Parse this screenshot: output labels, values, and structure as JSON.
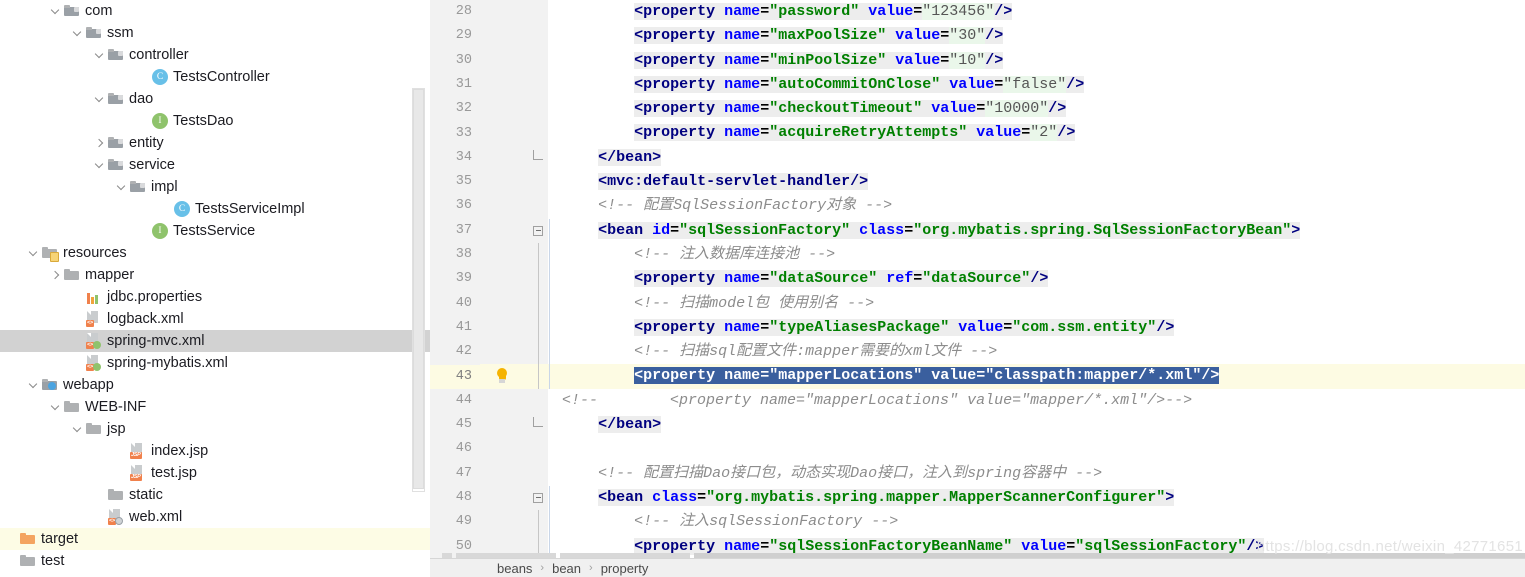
{
  "project_tree": {
    "items": [
      {
        "label": "com",
        "indent": 2,
        "arrow": "down",
        "icon": "package-folder-icon",
        "state": "none"
      },
      {
        "label": "ssm",
        "indent": 3,
        "arrow": "down",
        "icon": "package-folder-icon",
        "state": "none"
      },
      {
        "label": "controller",
        "indent": 4,
        "arrow": "down",
        "icon": "package-folder-icon",
        "state": "none"
      },
      {
        "label": "TestsController",
        "indent": 6,
        "arrow": "none",
        "icon": "java-class-icon",
        "state": "none"
      },
      {
        "label": "dao",
        "indent": 4,
        "arrow": "down",
        "icon": "package-folder-icon",
        "state": "none"
      },
      {
        "label": "TestsDao",
        "indent": 6,
        "arrow": "none",
        "icon": "java-interface-icon",
        "state": "none"
      },
      {
        "label": "entity",
        "indent": 4,
        "arrow": "right",
        "icon": "package-folder-icon",
        "state": "none"
      },
      {
        "label": "service",
        "indent": 4,
        "arrow": "down",
        "icon": "package-folder-icon",
        "state": "none"
      },
      {
        "label": "impl",
        "indent": 5,
        "arrow": "down",
        "icon": "package-folder-icon",
        "state": "none"
      },
      {
        "label": "TestsServiceImpl",
        "indent": 7,
        "arrow": "none",
        "icon": "java-class-icon",
        "state": "none"
      },
      {
        "label": "TestsService",
        "indent": 6,
        "arrow": "none",
        "icon": "java-interface-icon",
        "state": "none"
      },
      {
        "label": "resources",
        "indent": 1,
        "arrow": "down",
        "icon": "resources-folder-icon",
        "state": "none"
      },
      {
        "label": "mapper",
        "indent": 2,
        "arrow": "right",
        "icon": "folder-icon",
        "state": "none"
      },
      {
        "label": "jdbc.properties",
        "indent": 3,
        "arrow": "none",
        "icon": "properties-file-icon",
        "state": "none"
      },
      {
        "label": "logback.xml",
        "indent": 3,
        "arrow": "none",
        "icon": "xml-file-icon",
        "state": "none"
      },
      {
        "label": "spring-mvc.xml",
        "indent": 3,
        "arrow": "none",
        "icon": "spring-xml-file-icon",
        "state": "selected"
      },
      {
        "label": "spring-mybatis.xml",
        "indent": 3,
        "arrow": "none",
        "icon": "spring-xml-file-icon",
        "state": "none"
      },
      {
        "label": "webapp",
        "indent": 1,
        "arrow": "down",
        "icon": "webapp-folder-icon",
        "state": "none"
      },
      {
        "label": "WEB-INF",
        "indent": 2,
        "arrow": "down",
        "icon": "folder-icon",
        "state": "none"
      },
      {
        "label": "jsp",
        "indent": 3,
        "arrow": "down",
        "icon": "folder-icon",
        "state": "none"
      },
      {
        "label": "index.jsp",
        "indent": 5,
        "arrow": "none",
        "icon": "jsp-file-icon",
        "state": "none"
      },
      {
        "label": "test.jsp",
        "indent": 5,
        "arrow": "none",
        "icon": "jsp-file-icon",
        "state": "none"
      },
      {
        "label": "static",
        "indent": 4,
        "arrow": "none",
        "icon": "folder-icon",
        "state": "none"
      },
      {
        "label": "web.xml",
        "indent": 4,
        "arrow": "none",
        "icon": "web-xml-file-icon",
        "state": "none"
      },
      {
        "label": "target",
        "indent": 0,
        "arrow": "none",
        "icon": "excluded-folder-icon",
        "state": "marked"
      },
      {
        "label": "test",
        "indent": 0,
        "arrow": "none",
        "icon": "folder-icon",
        "state": "none"
      }
    ]
  },
  "editor": {
    "current_line": 43,
    "selected_line": 43,
    "gutter_bulb_line": 43,
    "lines": [
      {
        "n": 28,
        "indent": 8,
        "fold": "none",
        "tokens": [
          {
            "t": "<property ",
            "c": "tag",
            "bg": "hl"
          },
          {
            "t": "name",
            "c": "attr",
            "bg": "hl"
          },
          {
            "t": "=",
            "c": "punct",
            "bg": "hl"
          },
          {
            "t": "\"password\"",
            "c": "val",
            "bg": "hl"
          },
          {
            "t": " ",
            "c": "punct",
            "bg": "hl"
          },
          {
            "t": "value",
            "c": "attr",
            "bg": "hl"
          },
          {
            "t": "=",
            "c": "punct",
            "bg": "hl"
          },
          {
            "t": "\"123456\"",
            "c": "num",
            "bg": "hlg"
          },
          {
            "t": "/>",
            "c": "tag",
            "bg": "hl"
          }
        ]
      },
      {
        "n": 29,
        "indent": 8,
        "fold": "none",
        "tokens": [
          {
            "t": "<property ",
            "c": "tag",
            "bg": "hl"
          },
          {
            "t": "name",
            "c": "attr",
            "bg": "hl"
          },
          {
            "t": "=",
            "c": "punct",
            "bg": "hl"
          },
          {
            "t": "\"maxPoolSize\"",
            "c": "val",
            "bg": "hl"
          },
          {
            "t": " ",
            "c": "punct",
            "bg": "hl"
          },
          {
            "t": "value",
            "c": "attr",
            "bg": "hl"
          },
          {
            "t": "=",
            "c": "punct",
            "bg": "hl"
          },
          {
            "t": "\"30\"",
            "c": "num",
            "bg": "hlg"
          },
          {
            "t": "/>",
            "c": "tag",
            "bg": "hl"
          }
        ]
      },
      {
        "n": 30,
        "indent": 8,
        "fold": "none",
        "tokens": [
          {
            "t": "<property ",
            "c": "tag",
            "bg": "hl"
          },
          {
            "t": "name",
            "c": "attr",
            "bg": "hl"
          },
          {
            "t": "=",
            "c": "punct",
            "bg": "hl"
          },
          {
            "t": "\"minPoolSize\"",
            "c": "val",
            "bg": "hl"
          },
          {
            "t": " ",
            "c": "punct",
            "bg": "hl"
          },
          {
            "t": "value",
            "c": "attr",
            "bg": "hl"
          },
          {
            "t": "=",
            "c": "punct",
            "bg": "hl"
          },
          {
            "t": "\"10\"",
            "c": "num",
            "bg": "hlg"
          },
          {
            "t": "/>",
            "c": "tag",
            "bg": "hl"
          }
        ]
      },
      {
        "n": 31,
        "indent": 8,
        "fold": "none",
        "tokens": [
          {
            "t": "<property ",
            "c": "tag",
            "bg": "hl"
          },
          {
            "t": "name",
            "c": "attr",
            "bg": "hl"
          },
          {
            "t": "=",
            "c": "punct",
            "bg": "hl"
          },
          {
            "t": "\"autoCommitOnClose\"",
            "c": "val",
            "bg": "hl"
          },
          {
            "t": " ",
            "c": "punct",
            "bg": "hl"
          },
          {
            "t": "value",
            "c": "attr",
            "bg": "hl"
          },
          {
            "t": "=",
            "c": "punct",
            "bg": "hl"
          },
          {
            "t": "\"false\"",
            "c": "num",
            "bg": "hlg"
          },
          {
            "t": "/>",
            "c": "tag",
            "bg": "hl"
          }
        ]
      },
      {
        "n": 32,
        "indent": 8,
        "fold": "none",
        "tokens": [
          {
            "t": "<property ",
            "c": "tag",
            "bg": "hl"
          },
          {
            "t": "name",
            "c": "attr",
            "bg": "hl"
          },
          {
            "t": "=",
            "c": "punct",
            "bg": "hl"
          },
          {
            "t": "\"checkoutTimeout\"",
            "c": "val",
            "bg": "hl"
          },
          {
            "t": " ",
            "c": "punct",
            "bg": "hl"
          },
          {
            "t": "value",
            "c": "attr",
            "bg": "hl"
          },
          {
            "t": "=",
            "c": "punct",
            "bg": "hl"
          },
          {
            "t": "\"10000\"",
            "c": "num",
            "bg": "hlg"
          },
          {
            "t": "/>",
            "c": "tag",
            "bg": "hl"
          }
        ]
      },
      {
        "n": 33,
        "indent": 8,
        "fold": "none",
        "tokens": [
          {
            "t": "<property ",
            "c": "tag",
            "bg": "hl"
          },
          {
            "t": "name",
            "c": "attr",
            "bg": "hl"
          },
          {
            "t": "=",
            "c": "punct",
            "bg": "hl"
          },
          {
            "t": "\"acquireRetryAttempts\"",
            "c": "val",
            "bg": "hl"
          },
          {
            "t": " ",
            "c": "punct",
            "bg": "hl"
          },
          {
            "t": "value",
            "c": "attr",
            "bg": "hl"
          },
          {
            "t": "=",
            "c": "punct",
            "bg": "hl"
          },
          {
            "t": "\"2\"",
            "c": "num",
            "bg": "hlg"
          },
          {
            "t": "/>",
            "c": "tag",
            "bg": "hl"
          }
        ]
      },
      {
        "n": 34,
        "indent": 4,
        "fold": "end",
        "tokens": [
          {
            "t": "</bean>",
            "c": "tag",
            "bg": "hl"
          }
        ]
      },
      {
        "n": 35,
        "indent": 4,
        "fold": "none",
        "tokens": [
          {
            "t": "<mvc:default-servlet-handler/>",
            "c": "tag",
            "bg": "hl"
          }
        ]
      },
      {
        "n": 36,
        "indent": 4,
        "fold": "none",
        "tokens": [
          {
            "t": "<!-- 配置SqlSessionFactory对象 -->",
            "c": "cmt",
            "bg": "none"
          }
        ]
      },
      {
        "n": 37,
        "indent": 4,
        "fold": "start",
        "tokens": [
          {
            "t": "<bean ",
            "c": "tag",
            "bg": "hl"
          },
          {
            "t": "id",
            "c": "attr",
            "bg": "hl"
          },
          {
            "t": "=",
            "c": "punct",
            "bg": "hl"
          },
          {
            "t": "\"sqlSessionFactory\"",
            "c": "val",
            "bg": "hl"
          },
          {
            "t": " ",
            "c": "punct",
            "bg": "hl"
          },
          {
            "t": "class",
            "c": "attr",
            "bg": "hl"
          },
          {
            "t": "=",
            "c": "punct",
            "bg": "hl"
          },
          {
            "t": "\"org.mybatis.spring.SqlSessionFactoryBean\"",
            "c": "val",
            "bg": "hl"
          },
          {
            "t": ">",
            "c": "tag",
            "bg": "hl"
          }
        ]
      },
      {
        "n": 38,
        "indent": 8,
        "fold": "bar",
        "tokens": [
          {
            "t": "<!-- 注入数据库连接池 -->",
            "c": "cmt",
            "bg": "none"
          }
        ]
      },
      {
        "n": 39,
        "indent": 8,
        "fold": "bar",
        "tokens": [
          {
            "t": "<property ",
            "c": "tag",
            "bg": "hl"
          },
          {
            "t": "name",
            "c": "attr",
            "bg": "hl"
          },
          {
            "t": "=",
            "c": "punct",
            "bg": "hl"
          },
          {
            "t": "\"dataSource\"",
            "c": "val",
            "bg": "hl"
          },
          {
            "t": " ",
            "c": "punct",
            "bg": "hl"
          },
          {
            "t": "ref",
            "c": "attr",
            "bg": "hl"
          },
          {
            "t": "=",
            "c": "punct",
            "bg": "hl"
          },
          {
            "t": "\"dataSource\"",
            "c": "val",
            "bg": "hl"
          },
          {
            "t": "/>",
            "c": "tag",
            "bg": "hl"
          }
        ]
      },
      {
        "n": 40,
        "indent": 8,
        "fold": "bar",
        "tokens": [
          {
            "t": "<!-- 扫描model包 使用别名 -->",
            "c": "cmt",
            "bg": "none"
          }
        ]
      },
      {
        "n": 41,
        "indent": 8,
        "fold": "bar",
        "tokens": [
          {
            "t": "<property ",
            "c": "tag",
            "bg": "hl"
          },
          {
            "t": "name",
            "c": "attr",
            "bg": "hl"
          },
          {
            "t": "=",
            "c": "punct",
            "bg": "hl"
          },
          {
            "t": "\"typeAliasesPackage\"",
            "c": "val",
            "bg": "hl"
          },
          {
            "t": " ",
            "c": "punct",
            "bg": "hl"
          },
          {
            "t": "value",
            "c": "attr",
            "bg": "hl"
          },
          {
            "t": "=",
            "c": "punct",
            "bg": "hl"
          },
          {
            "t": "\"com.ssm.entity\"",
            "c": "val",
            "bg": "hl"
          },
          {
            "t": "/>",
            "c": "tag",
            "bg": "hl"
          }
        ]
      },
      {
        "n": 42,
        "indent": 8,
        "fold": "bar",
        "tokens": [
          {
            "t": "<!-- 扫描sql配置文件:mapper需要的xml文件 -->",
            "c": "cmt",
            "bg": "none"
          }
        ]
      },
      {
        "n": 43,
        "indent": 8,
        "fold": "bar",
        "selected": true,
        "tokens": [
          {
            "t": "<property ",
            "c": "tag",
            "bg": "none"
          },
          {
            "t": "name",
            "c": "attr",
            "bg": "none"
          },
          {
            "t": "=",
            "c": "punct",
            "bg": "none"
          },
          {
            "t": "\"mapperLocations\"",
            "c": "val",
            "bg": "none"
          },
          {
            "t": " ",
            "c": "punct",
            "bg": "none"
          },
          {
            "t": "value",
            "c": "attr",
            "bg": "none"
          },
          {
            "t": "=",
            "c": "punct",
            "bg": "none"
          },
          {
            "t": "\"classpath:mapper/*.xml\"",
            "c": "val",
            "bg": "none"
          },
          {
            "t": "/>",
            "c": "tag",
            "bg": "none"
          }
        ]
      },
      {
        "n": 44,
        "indent": 0,
        "fold": "none",
        "tokens": [
          {
            "t": "<!--        <property name=\"mapperLocations\" value=\"mapper/*.xml\"/>-->",
            "c": "cmt",
            "bg": "none"
          }
        ]
      },
      {
        "n": 45,
        "indent": 4,
        "fold": "end",
        "tokens": [
          {
            "t": "</bean>",
            "c": "tag",
            "bg": "hl"
          }
        ]
      },
      {
        "n": 46,
        "indent": 0,
        "fold": "none",
        "tokens": []
      },
      {
        "n": 47,
        "indent": 4,
        "fold": "none",
        "tokens": [
          {
            "t": "<!-- 配置扫描Dao接口包，动态实现Dao接口，注入到spring容器中 -->",
            "c": "cmt",
            "bg": "none"
          }
        ]
      },
      {
        "n": 48,
        "indent": 4,
        "fold": "start",
        "tokens": [
          {
            "t": "<bean ",
            "c": "tag",
            "bg": "hl"
          },
          {
            "t": "class",
            "c": "attr",
            "bg": "hl"
          },
          {
            "t": "=",
            "c": "punct",
            "bg": "hl"
          },
          {
            "t": "\"org.mybatis.spring.mapper.MapperScannerConfigurer\"",
            "c": "val",
            "bg": "hl"
          },
          {
            "t": ">",
            "c": "tag",
            "bg": "hl"
          }
        ]
      },
      {
        "n": 49,
        "indent": 8,
        "fold": "bar",
        "tokens": [
          {
            "t": "<!-- 注入sqlSessionFactory -->",
            "c": "cmt",
            "bg": "none"
          }
        ]
      },
      {
        "n": 50,
        "indent": 8,
        "fold": "bar",
        "tokens": [
          {
            "t": "<property ",
            "c": "tag",
            "bg": "hl"
          },
          {
            "t": "name",
            "c": "attr",
            "bg": "hl"
          },
          {
            "t": "=",
            "c": "punct",
            "bg": "hl"
          },
          {
            "t": "\"sqlSessionFactoryBeanName\"",
            "c": "val",
            "bg": "hl"
          },
          {
            "t": " ",
            "c": "punct",
            "bg": "hl"
          },
          {
            "t": "value",
            "c": "attr",
            "bg": "hl"
          },
          {
            "t": "=",
            "c": "punct",
            "bg": "hl"
          },
          {
            "t": "\"sqlSessionFactory\"",
            "c": "val",
            "bg": "hl"
          },
          {
            "t": "/>",
            "c": "tag",
            "bg": "hl"
          }
        ]
      }
    ]
  },
  "breadcrumb": {
    "items": [
      "beans",
      "bean",
      "property"
    ],
    "separator": "›"
  },
  "watermark": {
    "text": "https://blog.csdn.net/weixin_42771651"
  },
  "colors": {
    "selection_blue": "#3a5f9e",
    "current_line_yellow": "#fdfbe3",
    "tree_selection_gray": "#d2d2d2",
    "tag_navy": "#000080",
    "attr_blue": "#0000ff",
    "value_green": "#008000",
    "comment_gray": "#8c8c8c",
    "bulb_yellow": "#f5b301"
  }
}
